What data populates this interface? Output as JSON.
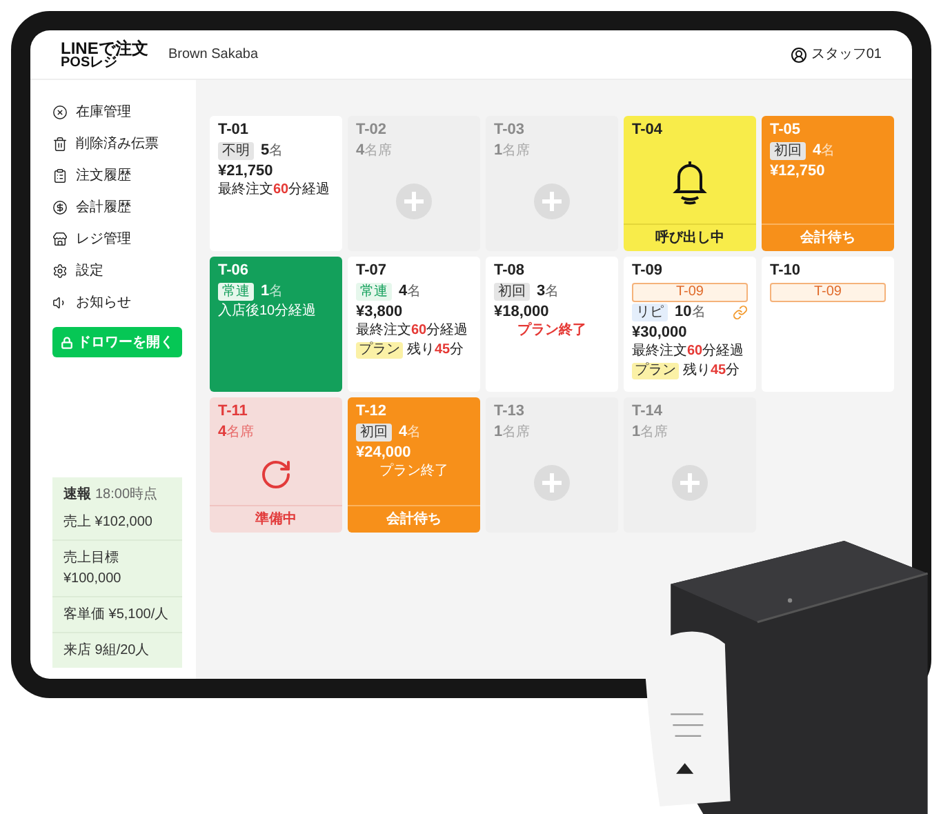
{
  "header": {
    "logo_top": "LINEで注文",
    "logo_bottom": "POSレジ",
    "store": "Brown Sakaba",
    "user": "スタッフ01"
  },
  "sidebar": {
    "items": [
      {
        "label": "在庫管理"
      },
      {
        "label": "削除済み伝票"
      },
      {
        "label": "注文履歴"
      },
      {
        "label": "会計履歴"
      },
      {
        "label": "レジ管理"
      },
      {
        "label": "設定"
      },
      {
        "label": "お知らせ"
      }
    ],
    "drawer_button": "ドロワーを開く",
    "report": {
      "title": "速報",
      "time": "18:00時点",
      "rows": [
        "売上 ¥102,000",
        "売上目標 ¥100,000",
        "客単価 ¥5,100/人",
        "来店 9組/20人"
      ]
    }
  },
  "tables": [
    {
      "id": "T-01",
      "kind": "occupied",
      "tag": {
        "label": "不明",
        "kind": "plain"
      },
      "count": "5",
      "unit": "名",
      "amount": "¥21,750",
      "lines": [
        {
          "kind": "note",
          "parts": [
            {
              "text": "最終注文"
            },
            {
              "text": "60",
              "alert": true
            },
            {
              "text": "分経過"
            }
          ]
        }
      ]
    },
    {
      "id": "T-02",
      "kind": "empty",
      "count": "4",
      "unit": "名席"
    },
    {
      "id": "T-03",
      "kind": "empty",
      "count": "1",
      "unit": "名席"
    },
    {
      "id": "T-04",
      "kind": "calling",
      "footer": "呼び出し中"
    },
    {
      "id": "T-05",
      "kind": "checkout",
      "tag": {
        "label": "初回",
        "kind": "plain"
      },
      "count": "4",
      "unit": "名",
      "amount": "¥12,750",
      "footer": "会計待ち"
    },
    {
      "id": "T-06",
      "kind": "regular",
      "tag": {
        "label": "常連",
        "kind": "regular"
      },
      "count": "1",
      "unit": "名",
      "lines": [
        {
          "kind": "note",
          "parts": [
            {
              "text": "入店後10分経過"
            }
          ]
        }
      ]
    },
    {
      "id": "T-07",
      "kind": "occupied",
      "tag": {
        "label": "常連",
        "kind": "regular"
      },
      "count": "4",
      "unit": "名",
      "amount": "¥3,800",
      "lines": [
        {
          "kind": "note",
          "parts": [
            {
              "text": "最終注文"
            },
            {
              "text": "60",
              "alert": true
            },
            {
              "text": "分経過"
            }
          ]
        },
        {
          "kind": "plan",
          "chip": "プラン",
          "parts": [
            {
              "text": "残り"
            },
            {
              "text": "45",
              "alert": true
            },
            {
              "text": "分"
            }
          ]
        }
      ]
    },
    {
      "id": "T-08",
      "kind": "occupied",
      "tag": {
        "label": "初回",
        "kind": "plain"
      },
      "count": "3",
      "unit": "名",
      "amount": "¥18,000",
      "lines": [
        {
          "kind": "alert",
          "parts": [
            {
              "text": "プラン終了"
            }
          ]
        }
      ]
    },
    {
      "id": "T-09",
      "kind": "occupied",
      "badge": "T-09",
      "linked": true,
      "tag": {
        "label": "リピ",
        "kind": "repeat"
      },
      "count": "10",
      "unit": "名",
      "amount": "¥30,000",
      "lines": [
        {
          "kind": "note",
          "parts": [
            {
              "text": "最終注文"
            },
            {
              "text": "60",
              "alert": true
            },
            {
              "text": "分経過"
            }
          ]
        },
        {
          "kind": "plan",
          "chip": "プラン",
          "parts": [
            {
              "text": "残り"
            },
            {
              "text": "45",
              "alert": true
            },
            {
              "text": "分"
            }
          ]
        }
      ]
    },
    {
      "id": "T-10",
      "kind": "occupied",
      "badge": "T-09"
    },
    {
      "id": "T-11",
      "kind": "preparing",
      "count": "4",
      "unit": "名席",
      "footer": "準備中"
    },
    {
      "id": "T-12",
      "kind": "checkout",
      "tag": {
        "label": "初回",
        "kind": "plain"
      },
      "count": "4",
      "unit": "名",
      "amount": "¥24,000",
      "lines": [
        {
          "kind": "plain",
          "parts": [
            {
              "text": "プラン終了"
            }
          ]
        }
      ],
      "footer": "会計待ち"
    },
    {
      "id": "T-13",
      "kind": "empty",
      "count": "1",
      "unit": "名席"
    },
    {
      "id": "T-14",
      "kind": "empty",
      "count": "1",
      "unit": "名席"
    }
  ]
}
